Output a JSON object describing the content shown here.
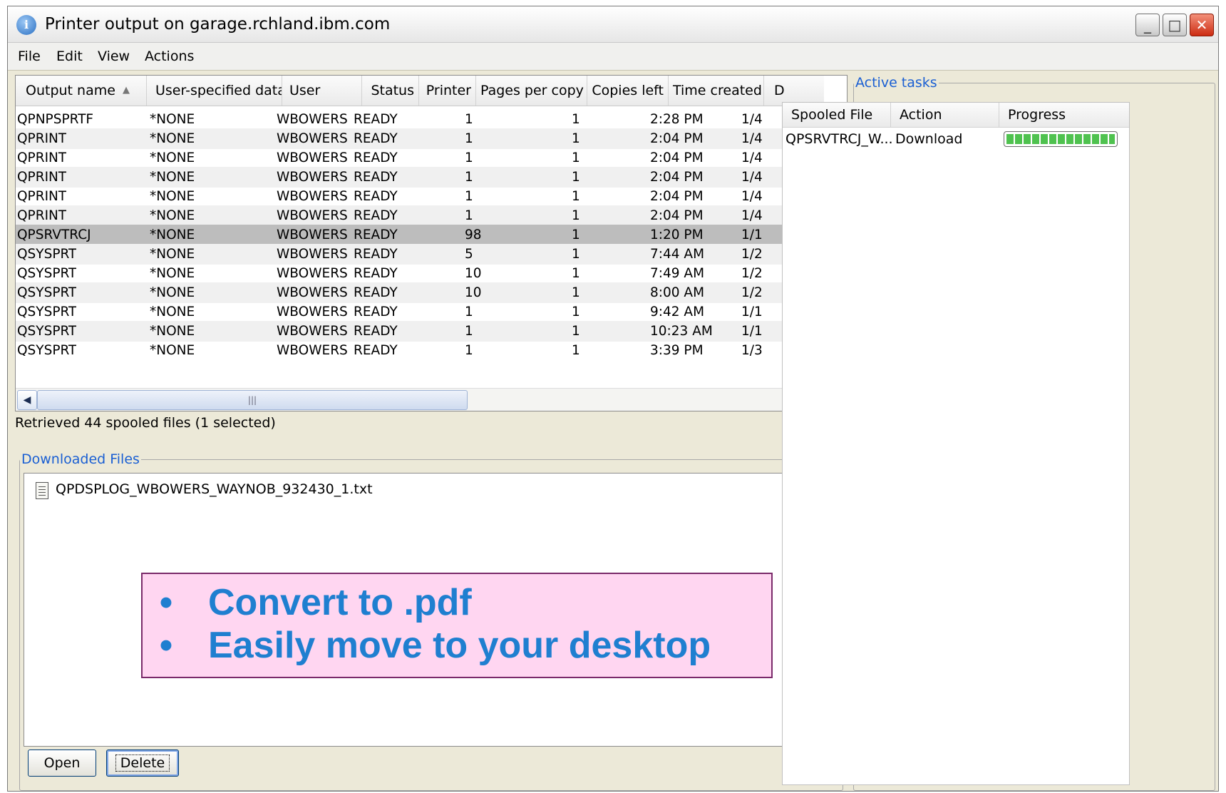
{
  "window": {
    "title": "Printer output on garage.rchland.ibm.com",
    "title_icon": "info-icon",
    "controls": {
      "minimize": "_",
      "maximize": "□",
      "close": "✕"
    }
  },
  "menu": [
    "File",
    "Edit",
    "View",
    "Actions"
  ],
  "table": {
    "sort_column": "Output name",
    "sort_indicator": "▲",
    "columns": [
      "Output name",
      "User-specified data",
      "User",
      "Status",
      "Printer",
      "Pages per copy",
      "Copies left",
      "Time created",
      "D"
    ],
    "rows": [
      {
        "name": "QPNPSPRTF",
        "data": "*NONE",
        "user": "WBOWERS",
        "status": "READY",
        "printer": "",
        "pages": "1",
        "copies": "1",
        "time": "2:28 PM",
        "d": "1/4"
      },
      {
        "name": "QPRINT",
        "data": "*NONE",
        "user": "WBOWERS",
        "status": "READY",
        "printer": "",
        "pages": "1",
        "copies": "1",
        "time": "2:04 PM",
        "d": "1/4"
      },
      {
        "name": "QPRINT",
        "data": "*NONE",
        "user": "WBOWERS",
        "status": "READY",
        "printer": "",
        "pages": "1",
        "copies": "1",
        "time": "2:04 PM",
        "d": "1/4"
      },
      {
        "name": "QPRINT",
        "data": "*NONE",
        "user": "WBOWERS",
        "status": "READY",
        "printer": "",
        "pages": "1",
        "copies": "1",
        "time": "2:04 PM",
        "d": "1/4"
      },
      {
        "name": "QPRINT",
        "data": "*NONE",
        "user": "WBOWERS",
        "status": "READY",
        "printer": "",
        "pages": "1",
        "copies": "1",
        "time": "2:04 PM",
        "d": "1/4"
      },
      {
        "name": "QPRINT",
        "data": "*NONE",
        "user": "WBOWERS",
        "status": "READY",
        "printer": "",
        "pages": "1",
        "copies": "1",
        "time": "2:04 PM",
        "d": "1/4"
      },
      {
        "name": "QPSRVTRCJ",
        "data": "*NONE",
        "user": "WBOWERS",
        "status": "READY",
        "printer": "",
        "pages": "98",
        "copies": "1",
        "time": "1:20 PM",
        "d": "1/1",
        "selected": true
      },
      {
        "name": "QSYSPRT",
        "data": "*NONE",
        "user": "WBOWERS",
        "status": "READY",
        "printer": "",
        "pages": "5",
        "copies": "1",
        "time": "7:44 AM",
        "d": "1/2"
      },
      {
        "name": "QSYSPRT",
        "data": "*NONE",
        "user": "WBOWERS",
        "status": "READY",
        "printer": "",
        "pages": "10",
        "copies": "1",
        "time": "7:49 AM",
        "d": "1/2"
      },
      {
        "name": "QSYSPRT",
        "data": "*NONE",
        "user": "WBOWERS",
        "status": "READY",
        "printer": "",
        "pages": "10",
        "copies": "1",
        "time": "8:00 AM",
        "d": "1/2"
      },
      {
        "name": "QSYSPRT",
        "data": "*NONE",
        "user": "WBOWERS",
        "status": "READY",
        "printer": "",
        "pages": "1",
        "copies": "1",
        "time": "9:42 AM",
        "d": "1/1"
      },
      {
        "name": "QSYSPRT",
        "data": "*NONE",
        "user": "WBOWERS",
        "status": "READY",
        "printer": "",
        "pages": "1",
        "copies": "1",
        "time": "10:23 AM",
        "d": "1/1"
      },
      {
        "name": "QSYSPRT",
        "data": "*NONE",
        "user": "WBOWERS",
        "status": "READY",
        "printer": "",
        "pages": "1",
        "copies": "1",
        "time": "3:39 PM",
        "d": "1/3"
      }
    ],
    "scroll": {
      "up": "▲",
      "down": "▼",
      "left": "◀",
      "right": "▶",
      "grip": "|||"
    }
  },
  "status": {
    "text": "Retrieved 44 spooled files (1 selected)",
    "help_label": "?"
  },
  "downloaded": {
    "legend": "Downloaded Files",
    "files": [
      "QPDSPLOG_WBOWERS_WAYNOB_932430_1.txt"
    ],
    "open_label": "Open",
    "delete_label": "Delete"
  },
  "annotation": {
    "bullet": "•",
    "lines": [
      "Convert to .pdf",
      "Easily move to your desktop"
    ],
    "background": "#ffd6f1",
    "text_color": "#1f7fd0"
  },
  "active_tasks": {
    "legend": "Active tasks",
    "columns": [
      "Spooled File",
      "Action",
      "Progress"
    ],
    "rows": [
      {
        "file": "QPSRVTRCJ_W...",
        "action": "Download",
        "progress": 1.0
      }
    ]
  },
  "colors": {
    "legend": "#1a5fd3",
    "selection": "#bdbdbd",
    "progress": "#4fc24f"
  }
}
